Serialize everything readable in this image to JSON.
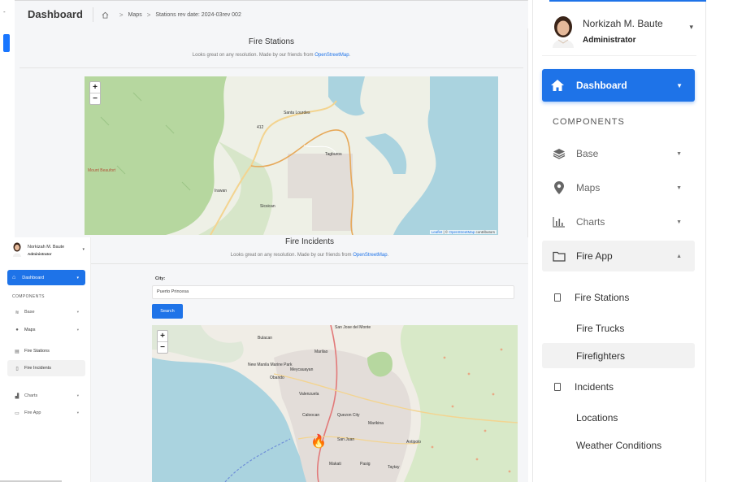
{
  "topbar": {
    "title": "Dashboard",
    "breadcrumb": [
      "Maps",
      "Stations rev date: 2024-03rev 002"
    ]
  },
  "fire_stations": {
    "title": "Fire Stations",
    "subtitle_prefix": "Looks great on any resolution. Made by our friends from ",
    "subtitle_link": "OpenStreetMap",
    "subtitle_suffix": ".",
    "map_labels": [
      "Santa Lourdes",
      "Tagburos",
      "Irawan",
      "Sicsican",
      "Mount Beaufort",
      "412"
    ],
    "attribution_leaflet": "Leaflet",
    "attribution_mid": " | © ",
    "attribution_osm": "OpenStreetMap",
    "attribution_suffix": " contributors"
  },
  "zoom": {
    "in": "+",
    "out": "−"
  },
  "fire_incidents": {
    "title": "Fire Incidents",
    "subtitle_prefix": "Looks great on any resolution. Made by our friends from ",
    "subtitle_link": "OpenStreetMap",
    "subtitle_suffix": ".",
    "city_label": "City:",
    "city_value": "Puerto Princesa",
    "search_label": "Search",
    "map_labels": [
      "San Jose del Monte",
      "Bulacan",
      "Meycauayan",
      "Valenzuela",
      "Caloocan",
      "Quezon City",
      "Marikina",
      "San Juan",
      "Antipolo",
      "Makati",
      "Pasig",
      "Taytay",
      "New Manila Marine Park",
      "Marilao",
      "Obando"
    ],
    "marker_icon": "🔥"
  },
  "mini_sidebar": {
    "user_name": "Norkizah M. Baute",
    "user_role": "Administrator",
    "dashboard": "Dashboard",
    "components": "COMPONENTS",
    "items": [
      {
        "label": "Base",
        "icon": "layers-icon"
      },
      {
        "label": "Maps",
        "icon": "map-pin-icon"
      },
      {
        "label": "Fire Stations",
        "icon": "building-icon"
      },
      {
        "label": "Fire Incidents",
        "icon": "square-icon"
      },
      {
        "label": "Charts",
        "icon": "chart-icon"
      },
      {
        "label": "Fire App",
        "icon": "folder-icon"
      }
    ]
  },
  "sidebar": {
    "user_name": "Norkizah M. Baute",
    "user_role": "Administrator",
    "dashboard": "Dashboard",
    "components": "COMPONENTS",
    "base": "Base",
    "maps": "Maps",
    "charts": "Charts",
    "fire_app": "Fire App",
    "fire_stations": "Fire Stations",
    "fire_trucks": "Fire Trucks",
    "firefighters": "Firefighters",
    "incidents": "Incidents",
    "locations": "Locations",
    "weather_conditions": "Weather Conditions"
  },
  "colors": {
    "accent": "#1e73e8",
    "panel_bg": "#f5f6f8",
    "forest": "#b5d59c",
    "water": "#aad3df"
  }
}
